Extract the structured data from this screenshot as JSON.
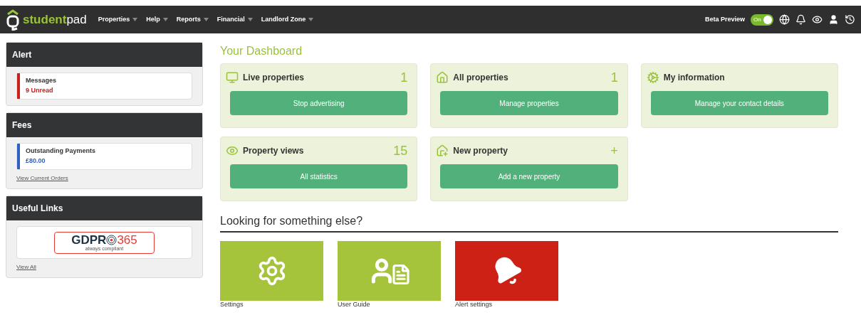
{
  "brand": {
    "name_bold": "student",
    "name_light": "pad"
  },
  "nav": [
    {
      "label": "Properties"
    },
    {
      "label": "Help"
    },
    {
      "label": "Reports"
    },
    {
      "label": "Financial"
    },
    {
      "label": "Landlord Zone"
    }
  ],
  "beta_preview": {
    "label": "Beta Preview",
    "toggle_label": "On",
    "on": true
  },
  "sidebar": [
    {
      "title": "Alert",
      "items": [
        {
          "title": "Messages",
          "value": "9 Unread",
          "color": "#c8201a"
        }
      ]
    },
    {
      "title": "Fees",
      "items": [
        {
          "title": "Outstanding Payments",
          "value": "£80.00",
          "color": "#2f62c0"
        }
      ],
      "link": "View Current Orders"
    },
    {
      "title": "Useful Links",
      "logo": {
        "word": "GDPR",
        "number": "365",
        "tagline": "always compliant"
      },
      "link": "View All"
    }
  ],
  "dashboard": {
    "title": "Your Dashboard",
    "cards": [
      {
        "kind": "live",
        "title": "Live properties",
        "count": "1",
        "button": "Stop advertising"
      },
      {
        "kind": "all",
        "title": "All properties",
        "count": "1",
        "button": "Manage properties"
      },
      {
        "kind": "info",
        "title": "My information",
        "button": "Manage your contact details"
      },
      {
        "kind": "views",
        "title": "Property views",
        "count": "15",
        "button": "All statistics"
      },
      {
        "kind": "new",
        "title": "New property",
        "count": "+",
        "button": "Add a new property"
      }
    ]
  },
  "more": {
    "title": "Looking for something else?",
    "tiles": [
      {
        "kind": "settings",
        "label": "Settings"
      },
      {
        "kind": "guide",
        "label": "User Guide"
      },
      {
        "kind": "alert",
        "label": "Alert settings"
      }
    ]
  }
}
